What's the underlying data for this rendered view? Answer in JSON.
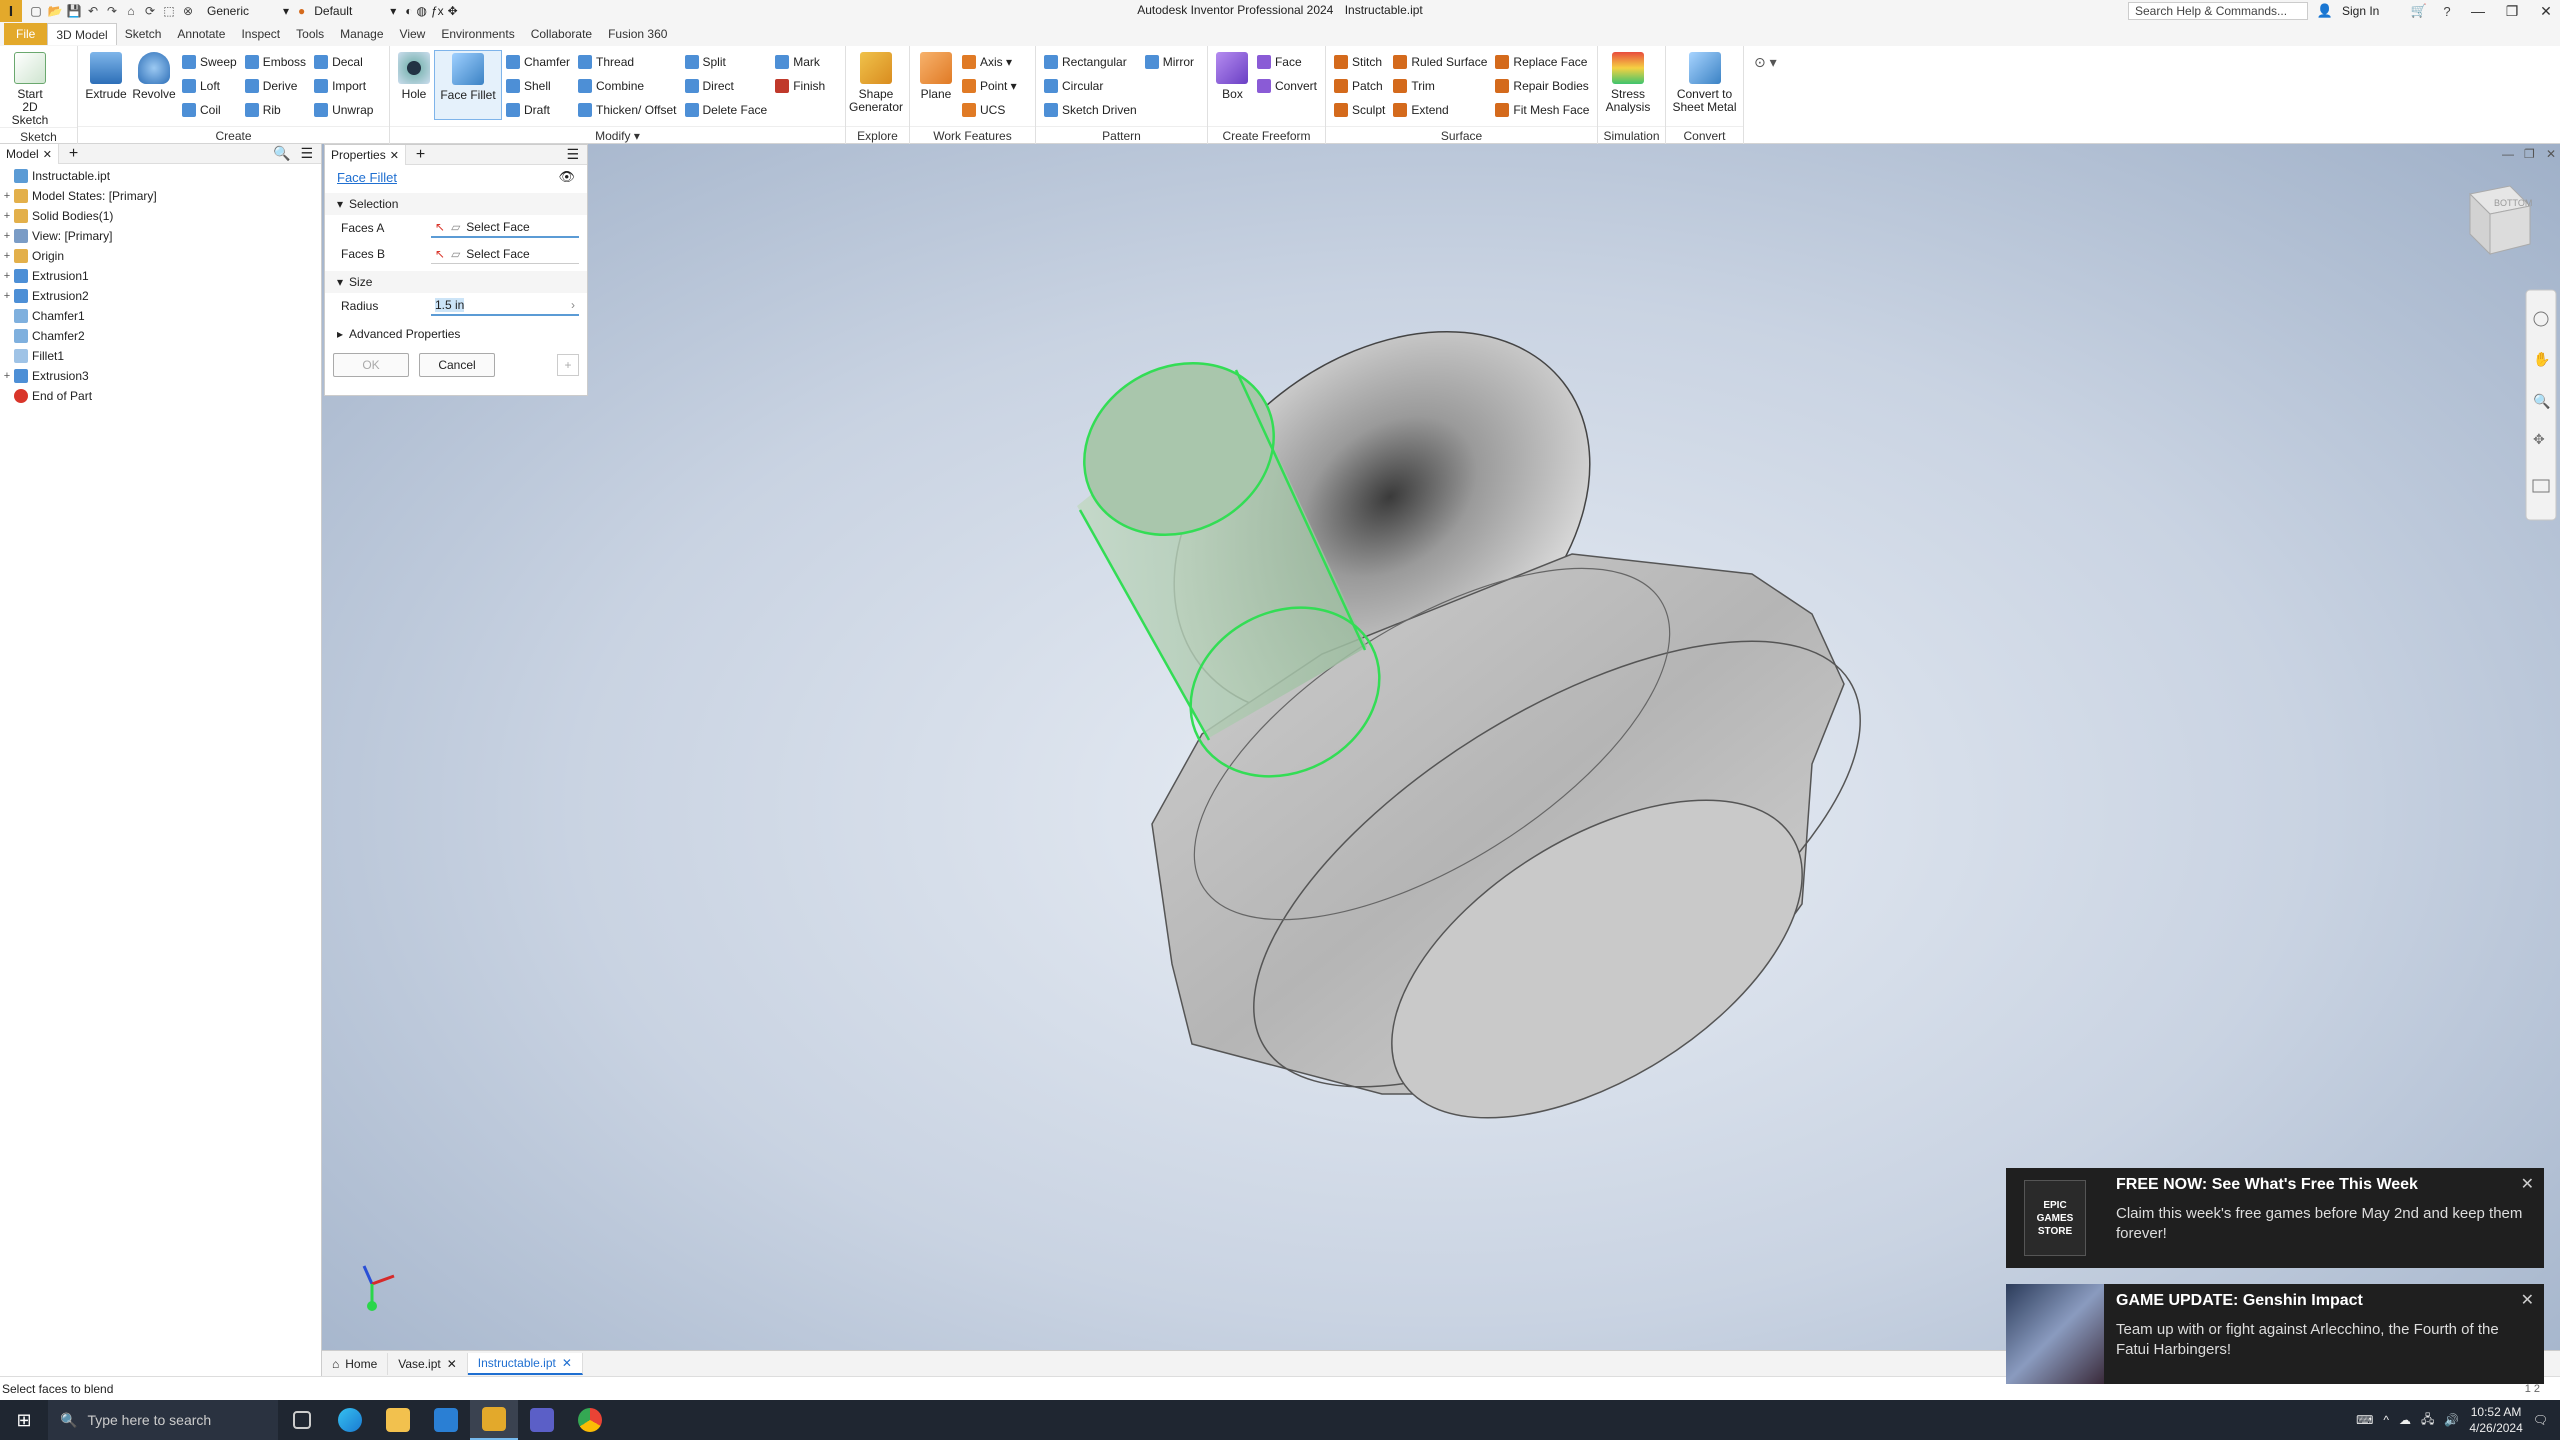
{
  "titlebar": {
    "logo": "I",
    "material": "Generic",
    "appearance": "Default",
    "app_name": "Autodesk Inventor Professional 2024",
    "document": "Instructable.ipt",
    "search_placeholder": "Search Help & Commands...",
    "sign_in": "Sign In"
  },
  "tabs": [
    "File",
    "3D Model",
    "Sketch",
    "Annotate",
    "Inspect",
    "Tools",
    "Manage",
    "View",
    "Environments",
    "Collaborate",
    "Fusion 360"
  ],
  "ribbon": {
    "sketch": {
      "title": "Sketch",
      "start": "Start\n2D Sketch"
    },
    "create": {
      "title": "Create",
      "extrude": "Extrude",
      "revolve": "Revolve",
      "col1": [
        "Sweep",
        "Loft",
        "Coil"
      ],
      "col2": [
        "Emboss",
        "Derive",
        "Rib"
      ],
      "col3": [
        "Decal",
        "Import",
        "Unwrap"
      ]
    },
    "modify": {
      "title": "Modify ▾",
      "hole": "Hole",
      "face_fillet": "Face Fillet",
      "col1": [
        "Chamfer",
        "Shell",
        "Draft"
      ],
      "col2": [
        "Thread",
        "Combine",
        "Thicken/ Offset"
      ],
      "col3": [
        "Split",
        "Direct",
        "Delete Face"
      ],
      "col4": [
        "Mark",
        "Finish"
      ]
    },
    "explore": {
      "title": "Explore",
      "shape_gen": "Shape\nGenerator"
    },
    "work": {
      "title": "Work Features",
      "plane": "Plane",
      "col1": [
        "Axis ▾",
        "Point ▾",
        "UCS"
      ]
    },
    "pattern": {
      "title": "Pattern",
      "col1": [
        "Rectangular",
        "Circular",
        "Sketch Driven"
      ],
      "col2": [
        "Mirror"
      ]
    },
    "freeform": {
      "title": "Create Freeform",
      "box": "Box",
      "col1": [
        "Face",
        "Convert"
      ]
    },
    "surface": {
      "title": "Surface",
      "col1": [
        "Stitch",
        "Patch",
        "Sculpt"
      ],
      "col2": [
        "Ruled Surface",
        "Trim",
        "Extend"
      ],
      "col3": [
        "Replace Face",
        "Repair Bodies",
        "Fit Mesh Face"
      ]
    },
    "simulation": {
      "title": "Simulation",
      "stress": "Stress\nAnalysis"
    },
    "convert": {
      "title": "Convert",
      "sheet": "Convert to\nSheet Metal"
    }
  },
  "model_browser": {
    "tab": "Model",
    "items": [
      "Instructable.ipt",
      "Model States: [Primary]",
      "Solid Bodies(1)",
      "View: [Primary]",
      "Origin",
      "Extrusion1",
      "Extrusion2",
      "Chamfer1",
      "Chamfer2",
      "Fillet1",
      "Extrusion3",
      "End of Part"
    ]
  },
  "properties": {
    "tab": "Properties",
    "title": "Face Fillet",
    "selection_header": "Selection",
    "faces_a_label": "Faces A",
    "faces_b_label": "Faces B",
    "select_face": "Select Face",
    "size_header": "Size",
    "radius_label": "Radius",
    "radius_value": "1.5 in",
    "advanced": "Advanced Properties",
    "ok": "OK",
    "cancel": "Cancel"
  },
  "viewcube_label": "BOTTOM",
  "doc_tabs": [
    "Home",
    "Vase.ipt",
    "Instructable.ipt"
  ],
  "status": "Select faces to blend",
  "page_numbers": "1   2",
  "taskbar": {
    "search": "Type here to search",
    "time": "10:52 AM",
    "date": "4/26/2024"
  },
  "notifications": [
    {
      "title": "FREE NOW: See What's Free This Week",
      "text": "Claim this week's free games before May 2nd and keep them forever!",
      "image_label": "EPIC GAMES STORE"
    },
    {
      "title": "GAME UPDATE: Genshin Impact",
      "text": "Team up with or fight against Arlecchino, the Fourth of the Fatui Harbingers!"
    }
  ]
}
